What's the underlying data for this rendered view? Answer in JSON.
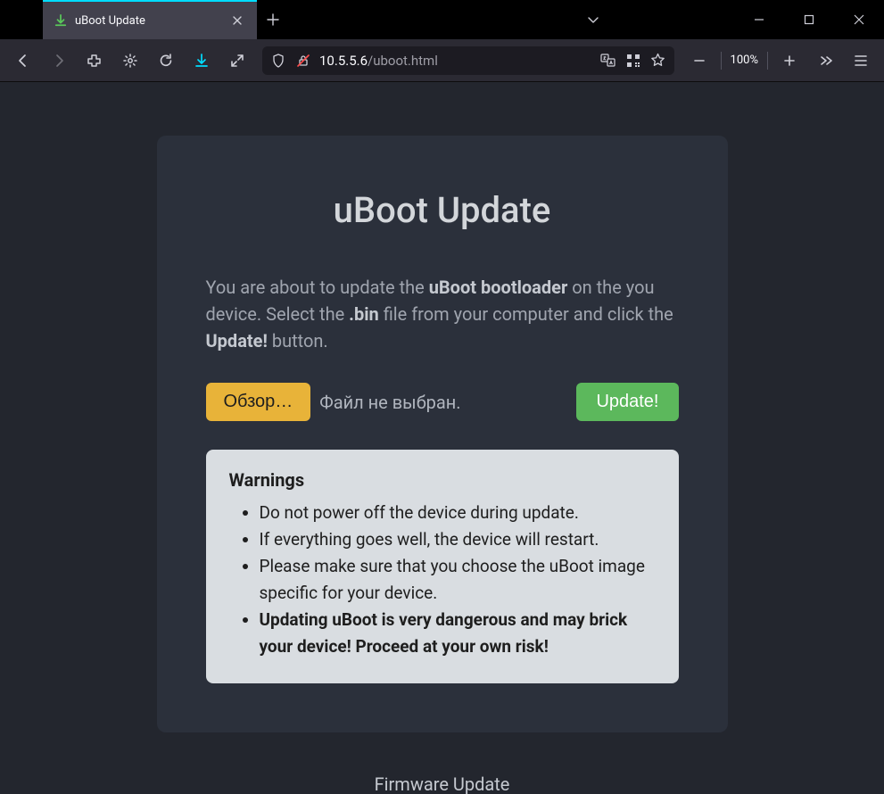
{
  "window": {
    "tab_title": "uBoot Update"
  },
  "toolbar": {
    "url_host": "10.5.5.6",
    "url_path": "/uboot.html",
    "zoom": "100%"
  },
  "page": {
    "title": "uBoot Update",
    "desc_p1": "You are about to update the ",
    "desc_b1": "uBoot bootloader",
    "desc_p2": " on the you device. Select the ",
    "desc_b2": ".bin",
    "desc_p3": " file from your computer and click the ",
    "desc_b3": "Update!",
    "desc_p4": " button.",
    "browse_label": "Обзор…",
    "file_status": "Файл не выбран.",
    "update_label": "Update!",
    "warnings_title": "Warnings",
    "warnings": [
      "Do not power off the device during update.",
      "If everything goes well, the device will restart.",
      "Please make sure that you choose the uBoot image specific for your device.",
      "Updating uBoot is very dangerous and may brick your device! Proceed at your own risk!"
    ],
    "footer_link": "Firmware Update"
  }
}
